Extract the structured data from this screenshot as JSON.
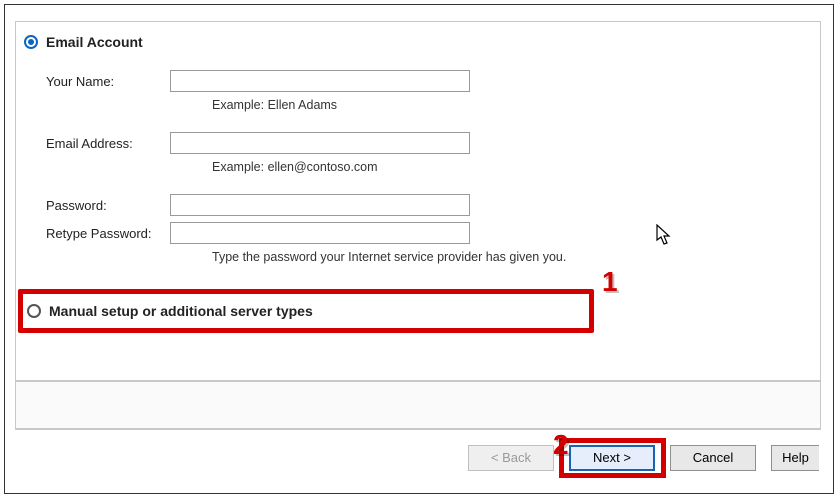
{
  "radios": {
    "email_account_label": "Email Account",
    "manual_setup_label": "Manual setup or additional server types"
  },
  "fields": {
    "your_name": {
      "label": "Your Name:",
      "value": "",
      "hint": "Example: Ellen Adams"
    },
    "email": {
      "label": "Email Address:",
      "value": "",
      "hint": "Example: ellen@contoso.com"
    },
    "password": {
      "label": "Password:",
      "value": ""
    },
    "retype": {
      "label": "Retype Password:",
      "value": "",
      "hint": "Type the password your Internet service provider has given you."
    }
  },
  "buttons": {
    "back": "< Back",
    "next": "Next >",
    "cancel": "Cancel",
    "help": "Help"
  },
  "annotations": {
    "one": "1",
    "two": "2"
  }
}
